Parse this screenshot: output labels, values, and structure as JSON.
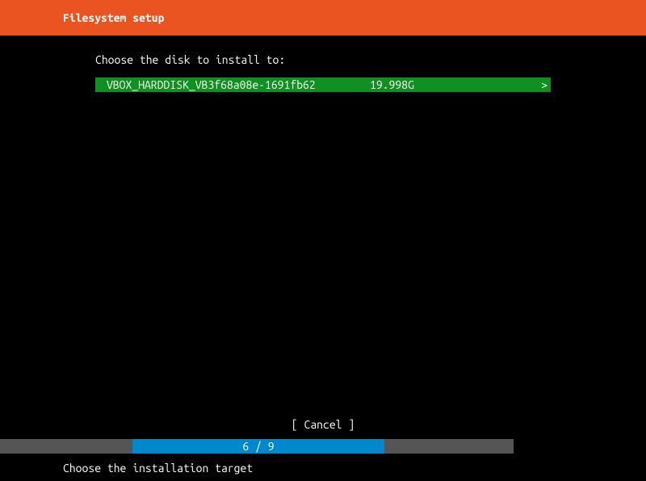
{
  "header": {
    "title": "Filesystem setup"
  },
  "content": {
    "prompt": "Choose the disk to install to:",
    "disk": {
      "name": "VBOX_HARDDISK_VB3f68a08e-1691fb62",
      "size": "19.998G",
      "arrow": ">"
    }
  },
  "cancel": {
    "label": "[ Cancel    ]"
  },
  "progress": {
    "text": "6 / 9"
  },
  "footer": {
    "text": "Choose the installation target"
  }
}
